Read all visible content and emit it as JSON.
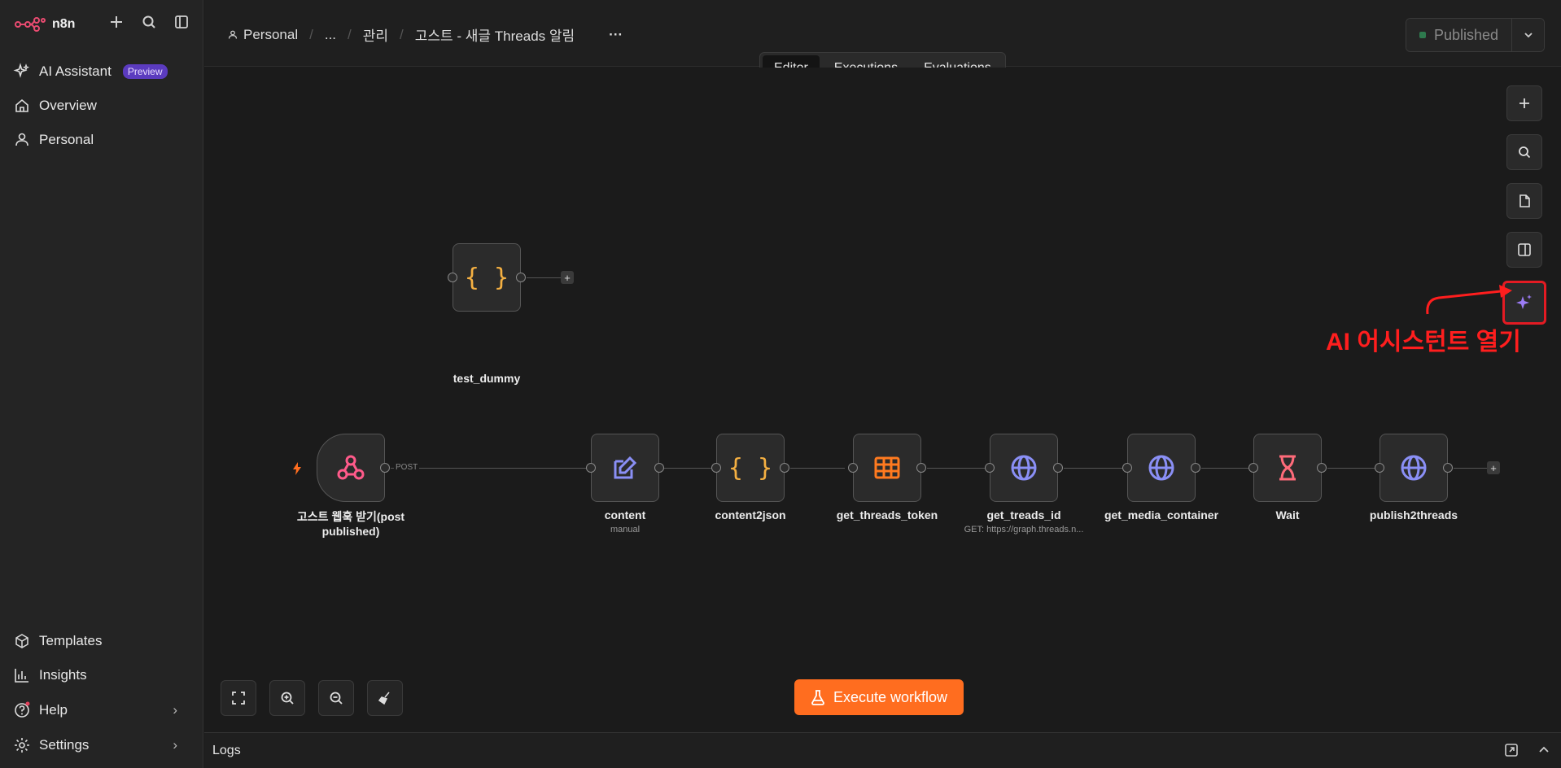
{
  "app": {
    "name": "n8n"
  },
  "sidebar": {
    "top_items": [
      {
        "label": "AI Assistant",
        "badge": "Preview",
        "icon": "sparkle-icon"
      },
      {
        "label": "Overview",
        "icon": "home-icon"
      },
      {
        "label": "Personal",
        "icon": "user-icon"
      }
    ],
    "bottom_items": [
      {
        "label": "Templates",
        "icon": "box-icon"
      },
      {
        "label": "Insights",
        "icon": "chart-icon"
      },
      {
        "label": "Help",
        "icon": "help-icon"
      },
      {
        "label": "Settings",
        "icon": "gear-icon"
      }
    ]
  },
  "header": {
    "breadcrumb": [
      "Personal",
      "...",
      "관리",
      "고스트 - 새글 Threads 알림"
    ],
    "more": "···",
    "publish_label": "Published"
  },
  "tabs": [
    {
      "label": "Editor",
      "active": true
    },
    {
      "label": "Executions",
      "active": false
    },
    {
      "label": "Evaluations",
      "active": false
    }
  ],
  "annotation": "AI 어시스턴트 열기",
  "nodes": [
    {
      "id": "test_dummy",
      "label": "test_dummy",
      "icon": "braces-icon"
    },
    {
      "id": "webhook",
      "label": "고스트 웹훅 받기(post published)",
      "icon": "webhook-icon"
    },
    {
      "id": "content",
      "label": "content",
      "sub": "manual",
      "icon": "edit-icon"
    },
    {
      "id": "content2json",
      "label": "content2json",
      "icon": "braces-icon"
    },
    {
      "id": "get_threads_token",
      "label": "get_threads_token",
      "icon": "table-icon"
    },
    {
      "id": "get_treads_id",
      "label": "get_treads_id",
      "sub": "GET: https://graph.threads.n...",
      "icon": "globe-icon"
    },
    {
      "id": "get_media_container",
      "label": "get_media_container",
      "icon": "globe-icon"
    },
    {
      "id": "wait",
      "label": "Wait",
      "icon": "hourglass-icon"
    },
    {
      "id": "publish2threads",
      "label": "publish2threads",
      "icon": "globe-icon"
    }
  ],
  "edge_tag": "POST",
  "execute_label": "Execute workflow",
  "logs_label": "Logs",
  "colors": {
    "accent": "#ff6d1f",
    "annotation": "#ff1e1e",
    "globe": "#8a8ff5",
    "braces": "#f5b042",
    "table": "#ff7a1f",
    "webhook": "#ff5a8a",
    "hourglass": "#ff6b7a"
  }
}
